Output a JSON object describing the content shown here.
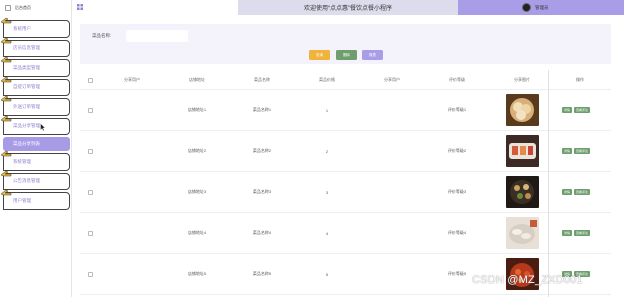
{
  "sidebar": {
    "brand": "后台首页",
    "items": [
      {
        "label": "系统用户"
      },
      {
        "label": "店员信息管理"
      },
      {
        "label": "菜品类型管理"
      },
      {
        "label": "自提订单管理"
      },
      {
        "label": "外送订单管理"
      },
      {
        "label": "菜品分享管理"
      },
      {
        "label": "系统管理"
      },
      {
        "label": "公告消息管理"
      },
      {
        "label": "用户管理"
      }
    ],
    "active_sub": "菜品分享列表"
  },
  "topbar": {
    "title": "欢迎使用“点点惠”餐饮点餐小程序",
    "username": "管理员"
  },
  "search": {
    "label": "菜品名称:",
    "value": "",
    "search_label": "查询",
    "delete_label": "删除",
    "stats_label": "报表"
  },
  "table": {
    "headers": [
      "分享用户",
      "店铺地址",
      "菜品名称",
      "菜品价格",
      "分享用户",
      "评价等级",
      "分享图片",
      "操作"
    ],
    "rows": [
      {
        "address": "店铺地址1",
        "dish": "菜品名称1",
        "price": "1",
        "rating": "评价等级1"
      },
      {
        "address": "店铺地址2",
        "dish": "菜品名称2",
        "price": "2",
        "rating": "评价等级2"
      },
      {
        "address": "店铺地址3",
        "dish": "菜品名称3",
        "price": "3",
        "rating": "评价等级3"
      },
      {
        "address": "店铺地址4",
        "dish": "菜品名称4",
        "price": "4",
        "rating": "评价等级4"
      },
      {
        "address": "店铺地址5",
        "dish": "菜品名称5",
        "price": "5",
        "rating": "评价等级5"
      }
    ],
    "action_detail": "详情",
    "action_review": "查看评论"
  },
  "watermark": "CSDN @MZ_ZXD001",
  "colors": {
    "accent": "#a99de8",
    "title_bar": "#dcdcec",
    "search_btn": "#f0b43c",
    "green_btn": "#6e9e6e",
    "menu_text": "#8f7fd0"
  }
}
